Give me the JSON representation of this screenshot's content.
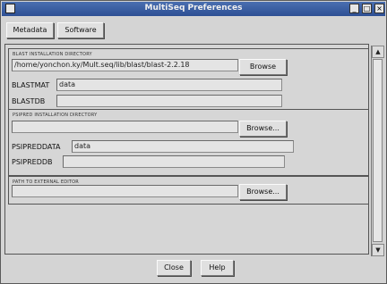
{
  "window": {
    "title": "MultiSeq Preferences",
    "min_glyph": "_",
    "max_glyph": "□",
    "close_glyph": "×"
  },
  "tabs": {
    "metadata_label": "Metadata",
    "software_label": "Software"
  },
  "blast": {
    "title": "BLAST INSTALLATION DIRECTORY",
    "path_value": "/home/yonchon.ky/Mult.seq/lib/blast/blast-2.2.18",
    "browse_label": "Browse",
    "blastmat_label": "BLASTMAT",
    "blastmat_value": "data",
    "blastdb_label": "BLASTDB",
    "blastdb_value": ""
  },
  "psipred": {
    "title": "PSIPRED INSTALLATION DIRECTORY",
    "path_value": "",
    "browse_label": "Browse...",
    "psipreddata_label": "PSIPREDDATA",
    "psipreddata_value": "data",
    "psipreddb_label": "PSIPREDDB",
    "psipreddb_value": ""
  },
  "external": {
    "title": "PATH TO EXTERNAL EDITOR",
    "path_value": "",
    "browse_label": "Browse..."
  },
  "footer": {
    "close_label": "Close",
    "help_label": "Help"
  },
  "scrollbar": {
    "up_glyph": "▲",
    "down_glyph": "▼"
  }
}
